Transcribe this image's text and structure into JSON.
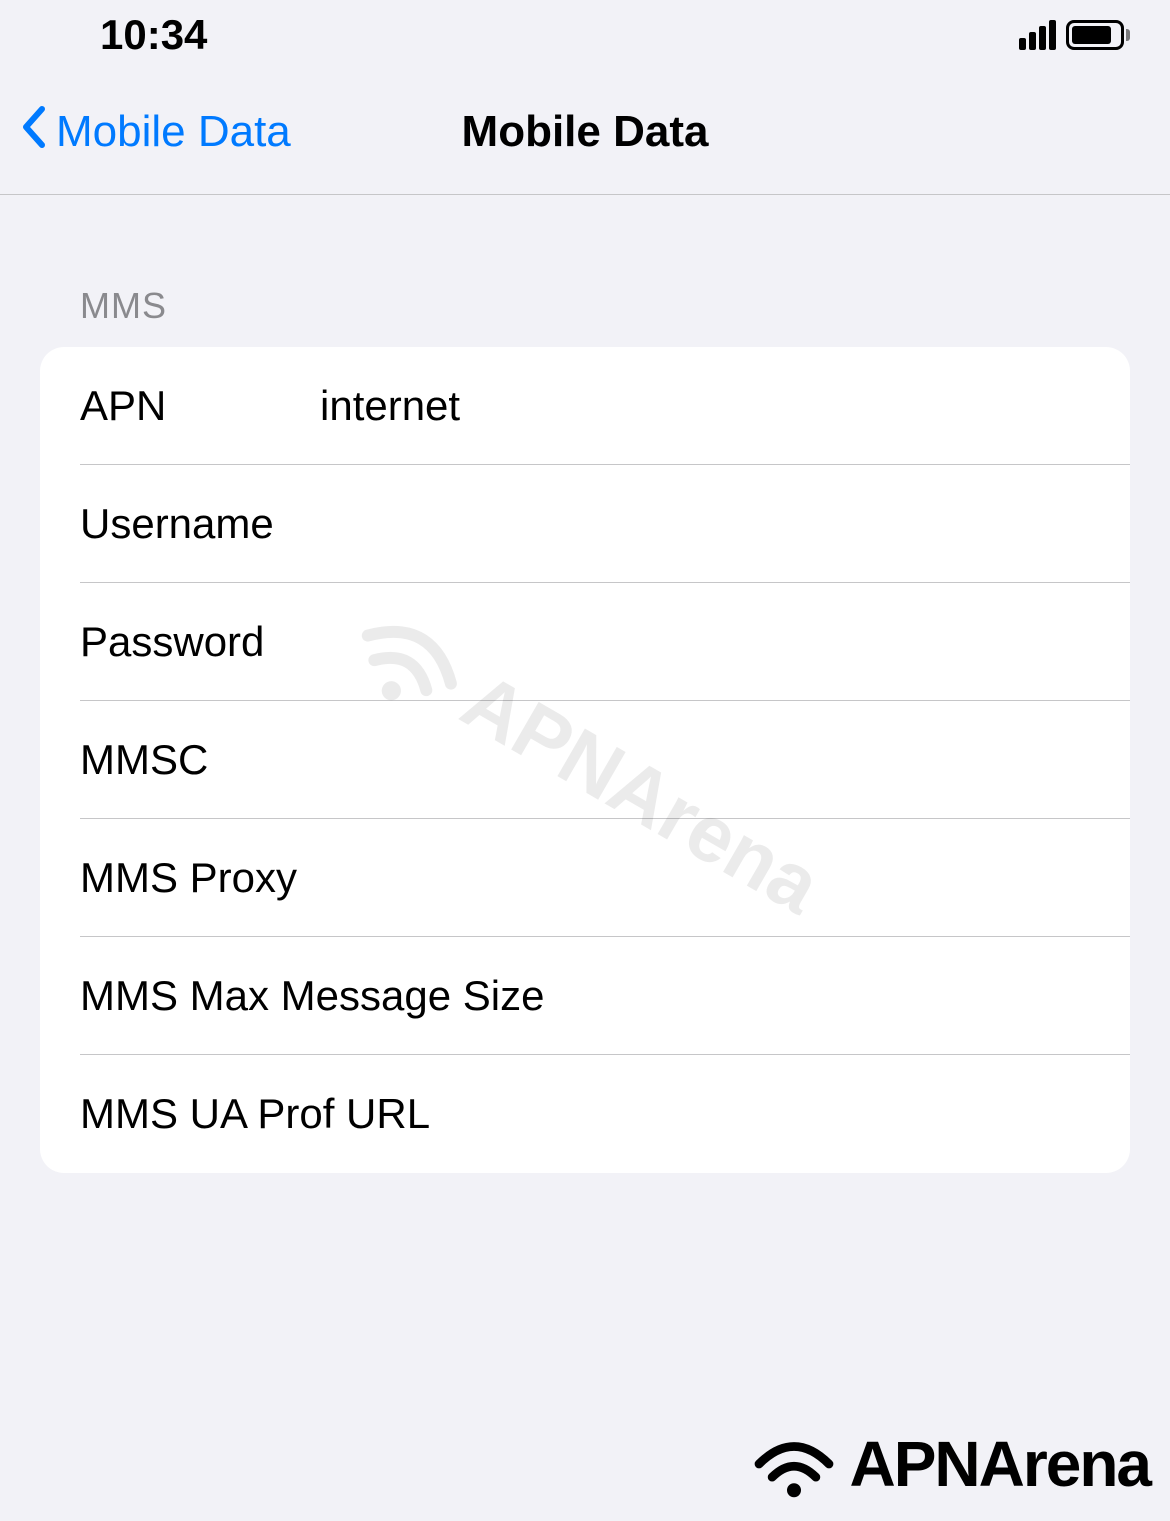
{
  "status_bar": {
    "time": "10:34"
  },
  "nav": {
    "back_label": "Mobile Data",
    "title": "Mobile Data"
  },
  "section": {
    "header": "MMS",
    "rows": {
      "apn": {
        "label": "APN",
        "value": "internet"
      },
      "username": {
        "label": "Username",
        "value": ""
      },
      "password": {
        "label": "Password",
        "value": ""
      },
      "mmsc": {
        "label": "MMSC",
        "value": ""
      },
      "mms_proxy": {
        "label": "MMS Proxy",
        "value": ""
      },
      "mms_max_msg": {
        "label": "MMS Max Message Size",
        "value": ""
      },
      "mms_ua_prof": {
        "label": "MMS UA Prof URL",
        "value": ""
      }
    }
  },
  "watermark": {
    "text_center": "APNArena",
    "text_bottom": "APNArena"
  }
}
